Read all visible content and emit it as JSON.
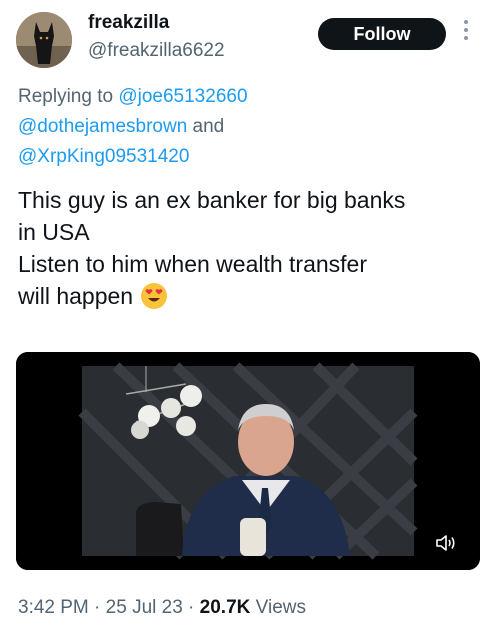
{
  "user": {
    "display_name": "freakzilla",
    "handle": "@freakzilla6622"
  },
  "follow_label": "Follow",
  "reply": {
    "prefix": "Replying to ",
    "mention1": "@joe65132660",
    "mention2": "@dothejamesbrown",
    "conjunction": " and",
    "mention3": "@XrpKing09531420"
  },
  "tweet": {
    "line1": "This guy is an ex banker for big banks",
    "line2": "in USA",
    "line3": "Listen to him when wealth transfer",
    "line4": "will happen"
  },
  "meta": {
    "time": "3:42 PM",
    "sep1": " · ",
    "date": "25 Jul 23",
    "sep2": " · ",
    "views_count": "20.7K",
    "views_label": " Views"
  },
  "icons": {
    "more": "more-vertical-icon",
    "mute": "speaker-muted-icon",
    "emoji": "heart-eyes-emoji"
  },
  "colors": {
    "accent": "#1d9bf0",
    "follow_bg": "#0f1419",
    "secondary_text": "#536471"
  }
}
